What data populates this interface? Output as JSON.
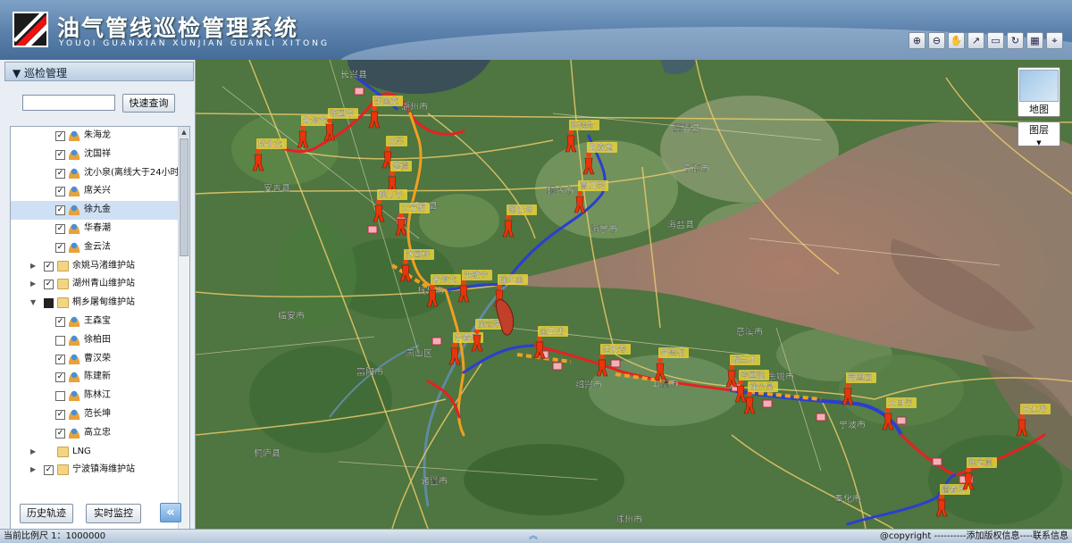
{
  "header": {
    "title": "油气管线巡检管理系统",
    "subtitle": "YOUQI GUANXIAN XUNJIAN GUANLI XITONG",
    "tools": [
      {
        "name": "zoom-in-icon",
        "glyph": "⊕"
      },
      {
        "name": "zoom-out-icon",
        "glyph": "⊖"
      },
      {
        "name": "pan-hand-icon",
        "glyph": "✋"
      },
      {
        "name": "measure-line-icon",
        "glyph": "↗"
      },
      {
        "name": "measure-area-icon",
        "glyph": "▭"
      },
      {
        "name": "refresh-icon",
        "glyph": "↻"
      },
      {
        "name": "map-layer-icon",
        "glyph": "▦"
      },
      {
        "name": "locate-icon",
        "glyph": "⌖"
      }
    ]
  },
  "sidebar": {
    "panel_title": "巡检管理",
    "search_button": "快速查询",
    "history_button": "历史轨迹",
    "live_button": "实时监控",
    "tree": [
      {
        "label": "朱海龙",
        "type": "person",
        "level": 2,
        "checked": "checked"
      },
      {
        "label": "沈国祥",
        "type": "person",
        "level": 2,
        "checked": "checked"
      },
      {
        "label": "沈小泉(离线大于24小时",
        "type": "person",
        "level": 2,
        "checked": "checked"
      },
      {
        "label": "席关兴",
        "type": "person",
        "level": 2,
        "checked": "checked"
      },
      {
        "label": "徐九金",
        "type": "person",
        "level": 2,
        "checked": "checked",
        "selected": true
      },
      {
        "label": "华春潮",
        "type": "person",
        "level": 2,
        "checked": "checked"
      },
      {
        "label": "金云法",
        "type": "person",
        "level": 2,
        "checked": "checked"
      },
      {
        "label": "余姚马渚维护站",
        "type": "folder",
        "level": 1,
        "checked": "checked",
        "arrow": "▶"
      },
      {
        "label": "湖州青山维护站",
        "type": "folder",
        "level": 1,
        "checked": "checked",
        "arrow": "▶"
      },
      {
        "label": "桐乡屠甸维护站",
        "type": "folder",
        "level": 1,
        "checked": "partial",
        "arrow": "▼"
      },
      {
        "label": "王森宝",
        "type": "person",
        "level": 2,
        "checked": "checked"
      },
      {
        "label": "徐柏田",
        "type": "person",
        "level": 2,
        "checked": "unchecked"
      },
      {
        "label": "曹汉荣",
        "type": "person",
        "level": 2,
        "checked": "checked"
      },
      {
        "label": "陈建新",
        "type": "person",
        "level": 2,
        "checked": "checked"
      },
      {
        "label": "陈林江",
        "type": "person",
        "level": 2,
        "checked": "unchecked"
      },
      {
        "label": "范长坤",
        "type": "person",
        "level": 2,
        "checked": "checked"
      },
      {
        "label": "高立忠",
        "type": "person",
        "level": 2,
        "checked": "checked"
      },
      {
        "label": "LNG",
        "type": "folder",
        "level": 1,
        "checked": "none",
        "arrow": "▶"
      },
      {
        "label": "宁波镇海维护站",
        "type": "folder",
        "level": 1,
        "checked": "checked",
        "arrow": "▶"
      }
    ]
  },
  "map": {
    "map_button": "地图",
    "layer_button": "图层",
    "colors": {
      "pipeline_main": "#2a3fd0",
      "pipeline_red": "#e42222",
      "pipeline_orange": "#f0a020",
      "marker_name_bg": "#e8d23a"
    },
    "cities": [
      "长兴县",
      "湖州市",
      "嘉善县",
      "平湖市",
      "安吉县",
      "德清县",
      "桐乡市",
      "海宁市",
      "海盐县",
      "杭州市",
      "临安市",
      "富阳市",
      "萧山区",
      "绍兴市",
      "上虞市",
      "慈溪市",
      "余姚市",
      "宁波市",
      "奉化市",
      "嵊州市",
      "诸暨市",
      "桐庐县"
    ],
    "inspectors": [
      "所永龙",
      "朱海龙",
      "陈国华",
      "邵金龙",
      "王苏",
      "连德",
      "姚万平",
      "王安明",
      "沈国祥",
      "朱海龙",
      "张敏宁",
      "徐九金",
      "华春潮",
      "徐志荣",
      "金云法",
      "陈建新",
      "王森宝",
      "曹汉荣",
      "范长坤",
      "汪长寿",
      "罗建明",
      "胡生才",
      "岑国强",
      "徐余皇",
      "劳惠国",
      "王自伟",
      "唐春良",
      "陈定康",
      "王仕法"
    ]
  },
  "status": {
    "scale": "当前比例尺 1：1000000",
    "copyright": "@copyright ----------添加版权信息----联系信息"
  }
}
